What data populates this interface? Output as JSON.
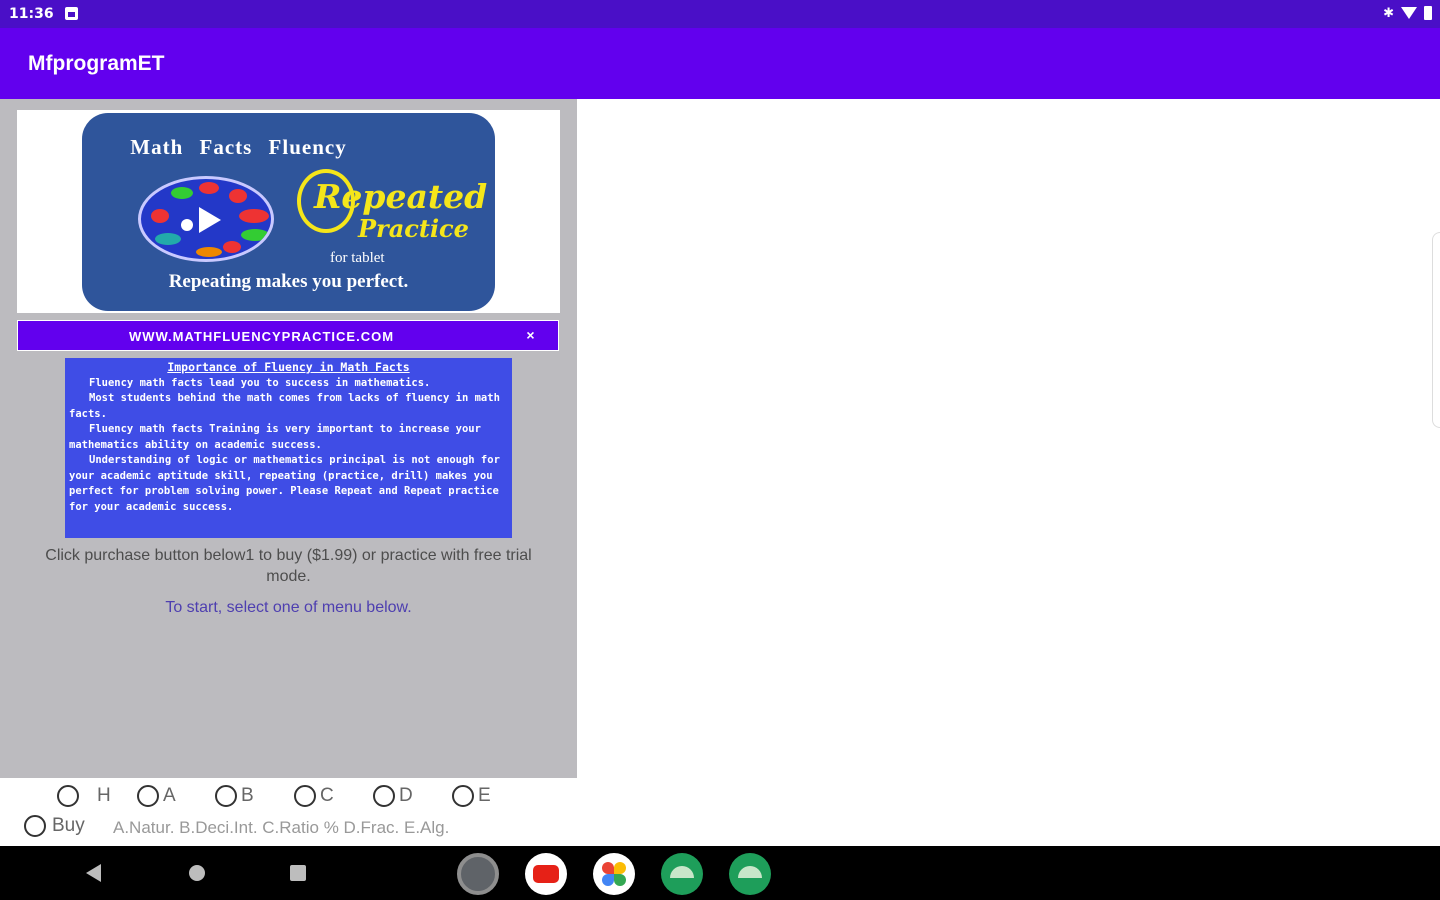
{
  "status_bar": {
    "time": "11:36"
  },
  "app_bar": {
    "title": "MfprogramET"
  },
  "logo": {
    "title": "Math  Facts  Fluency",
    "brand_line1": "Repeated",
    "brand_line2": "Practice",
    "subtitle": "for tablet",
    "tagline": "Repeating makes you perfect."
  },
  "ad_bar": {
    "url": "WWW.MATHFLUENCYPRACTICE.COM",
    "close_label": "×"
  },
  "info": {
    "title": "Importance of Fluency in Math Facts",
    "paragraphs": [
      "Fluency math facts lead you to success in mathematics.",
      "Most students behind the math comes from lacks of fluency in math facts.",
      "Fluency math facts Training is very important to increase your mathematics ability on academic success.",
      "Understanding of logic or mathematics principal is not enough for your academic aptitude skill, repeating (practice, drill) makes you perfect for problem solving power.   Please Repeat and Repeat practice for your academic success."
    ]
  },
  "purchase_text": "Click purchase button below1 to buy ($1.99) or practice with free trial mode.",
  "start_text": "To start, select one of menu below.",
  "radios": {
    "h": "H",
    "a": "A",
    "b": "B",
    "c": "C",
    "d": "D",
    "e": "E",
    "buy": "Buy",
    "sublabels": "A.Natur. B.Deci.Int. C.Ratio % D.Frac. E.Alg."
  },
  "colors": {
    "status_bar": "#4a0fc7",
    "app_bar": "#6200ee",
    "panel": "#bcbbbf",
    "info_box": "#3f4de6"
  },
  "dock_icons": [
    "settings-icon",
    "youtube-icon",
    "photos-icon",
    "android-app-icon",
    "android-app-icon"
  ]
}
